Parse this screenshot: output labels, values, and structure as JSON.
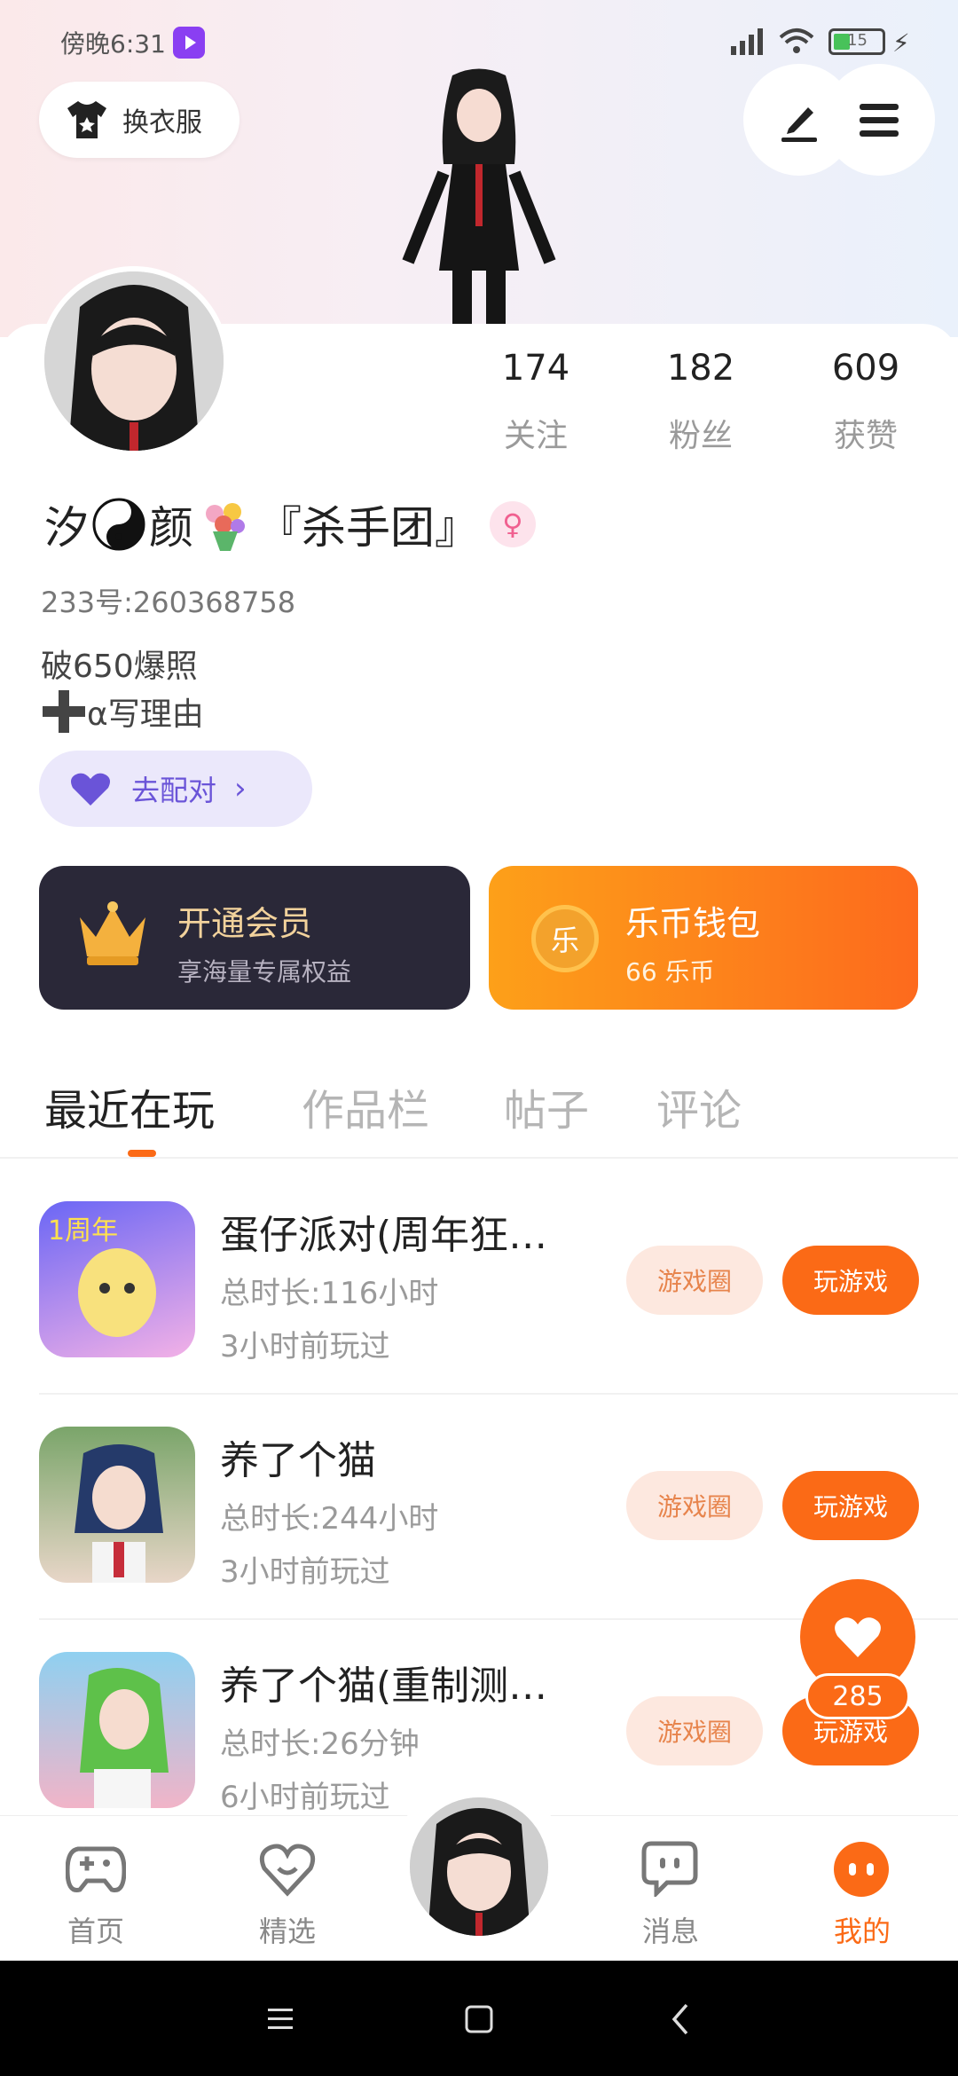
{
  "status": {
    "time": "傍晚6:31",
    "battery": "15"
  },
  "header": {
    "outfit_label": "换衣服"
  },
  "profile": {
    "stats": [
      {
        "value": "174",
        "label": "关注"
      },
      {
        "value": "182",
        "label": "粉丝"
      },
      {
        "value": "609",
        "label": "获赞"
      }
    ],
    "name_prefix": "汐",
    "name_mid": "颜",
    "name_suffix": "『杀手团』",
    "id_line": "233号:260368758",
    "bio_line1": "破650爆照",
    "bio_line2": "α写理由",
    "match_label": "去配对"
  },
  "cards": {
    "vip_title": "开通会员",
    "vip_sub": "享海量专属权益",
    "wallet_icon_text": "乐",
    "wallet_title": "乐币钱包",
    "wallet_sub": "66 乐币"
  },
  "tabs": [
    "最近在玩",
    "作品栏",
    "帖子",
    "评论"
  ],
  "games": [
    {
      "title": "蛋仔派对(周年狂…",
      "duration": "总时长:116小时",
      "last": "3小时前玩过",
      "circle_label": "游戏圈",
      "play_label": "玩游戏",
      "thumb_badge": "1周年"
    },
    {
      "title": "养了个猫",
      "duration": "总时长:244小时",
      "last": "3小时前玩过",
      "circle_label": "游戏圈",
      "play_label": "玩游戏",
      "thumb_badge": ""
    },
    {
      "title": "养了个猫(重制测…",
      "duration": "总时长:26分钟",
      "last": "6小时前玩过",
      "circle_label": "游戏圈",
      "play_label": "玩游戏",
      "thumb_badge": ""
    }
  ],
  "like_float": {
    "count": "285"
  },
  "bottom_nav": [
    {
      "label": "首页"
    },
    {
      "label": "精选"
    },
    {
      "label": ""
    },
    {
      "label": "消息"
    },
    {
      "label": "我的"
    }
  ],
  "colors": {
    "accent": "#fb6a16",
    "vip_bg": "#2a2838",
    "match_bg": "#ebe8fb"
  }
}
